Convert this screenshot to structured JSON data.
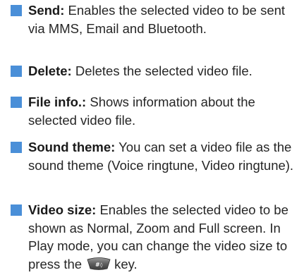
{
  "items": [
    {
      "term": "Send:",
      "desc": "Enables the selected video to be sent via MMS, Email and Bluetooth."
    },
    {
      "term": "Delete:",
      "desc": "Deletes the selected video file."
    },
    {
      "term": "File info.:",
      "desc": "Shows information about the selected video file."
    },
    {
      "term": "Sound theme:",
      "desc": "You can set a video file as the sound theme (Voice ringtune, Video ringtune)."
    },
    {
      "term": "Video size:",
      "desc": "Enables the selected video to be shown as Normal, Zoom and Full screen. In Play mode, you can change the video size to press the",
      "desc_after_icon": "key.",
      "key_icon": "hash-key-icon"
    }
  ],
  "colors": {
    "bullet": "#4a8fd8",
    "text": "#262626"
  }
}
